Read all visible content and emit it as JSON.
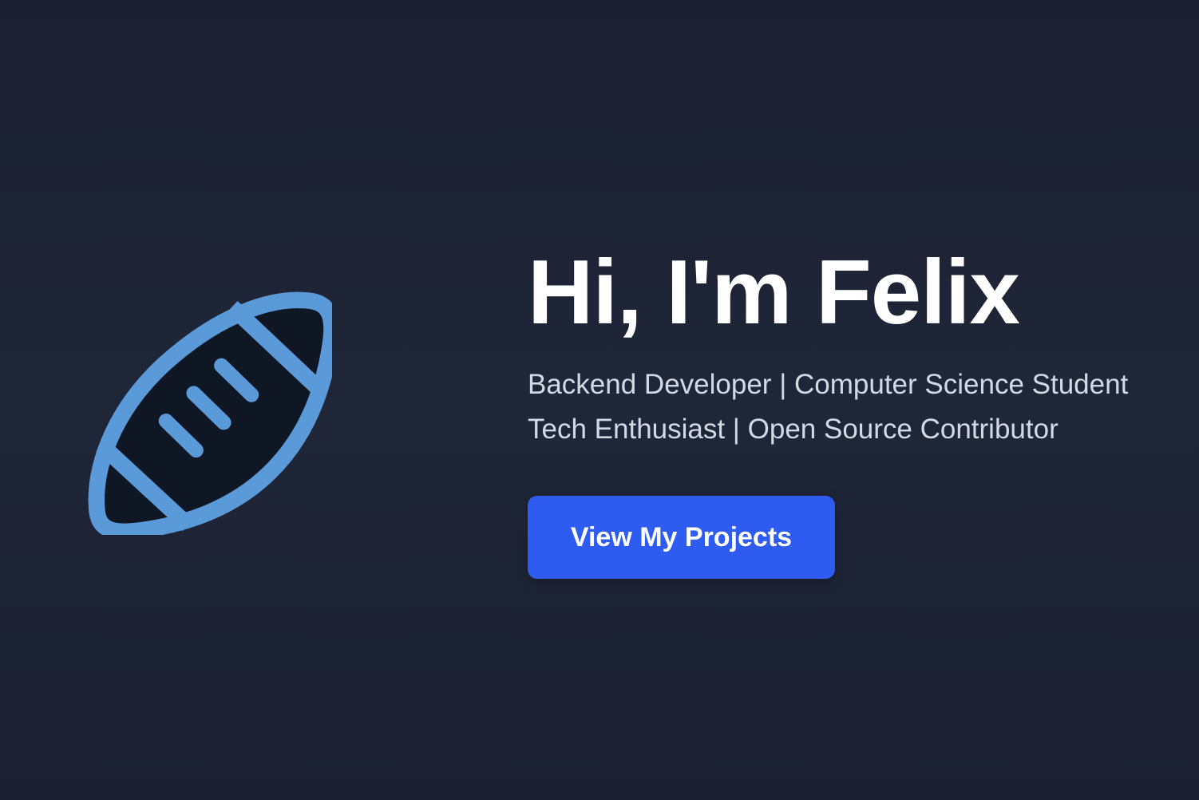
{
  "colors": {
    "background": "#1d2335",
    "accent": "#2f5cf0",
    "logo_stroke": "#5b9ad8",
    "logo_fill": "#0f1724",
    "subtitle": "#d3d9e4"
  },
  "logo": {
    "icon": "american-football-icon"
  },
  "hero": {
    "title": "Hi, I'm Felix",
    "subtitle_lines": [
      "Backend Developer | Computer Science Student",
      "Tech Enthusiast | Open Source Contributor"
    ],
    "cta_label": "View My Projects"
  }
}
